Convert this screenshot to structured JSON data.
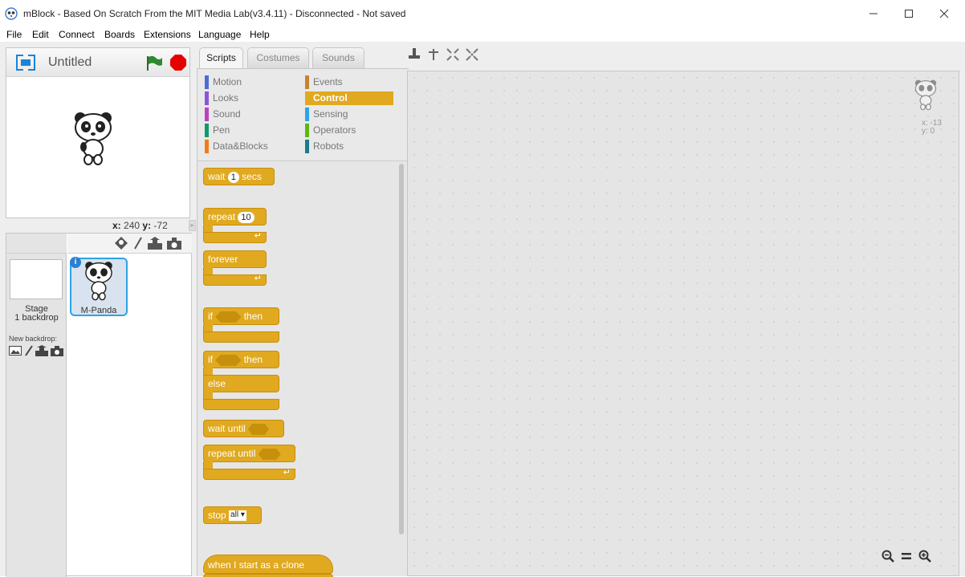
{
  "window": {
    "title": "mBlock - Based On Scratch From the MIT Media Lab(v3.4.11) - Disconnected - Not saved",
    "icon": "mblock-logo-icon",
    "controls": [
      "minimize-icon",
      "maximize-icon",
      "close-icon"
    ]
  },
  "menu": [
    "File",
    "Edit",
    "Connect",
    "Boards",
    "Extensions",
    "Language",
    "Help"
  ],
  "stage": {
    "project_title": "Untitled",
    "icons": [
      "fullscreen-icon",
      "green-flag-icon",
      "stop-icon"
    ],
    "mouse_x_label": "x:",
    "mouse_x": "240",
    "mouse_y_label": "y:",
    "mouse_y": "-72"
  },
  "sprites_panel": {
    "tool_icons": [
      "choose-sprite-icon",
      "paint-sprite-icon",
      "upload-sprite-icon",
      "camera-sprite-icon"
    ],
    "stage_label": "Stage",
    "stage_backdrops": "1 backdrop",
    "new_backdrop_label": "New backdrop:",
    "backdrop_icons": [
      "choose-backdrop-icon",
      "paint-backdrop-icon",
      "upload-backdrop-icon",
      "camera-backdrop-icon"
    ],
    "sprites": [
      {
        "name": "M-Panda",
        "selected": true
      }
    ]
  },
  "tabs": [
    {
      "label": "Scripts",
      "active": true
    },
    {
      "label": "Costumes",
      "active": false
    },
    {
      "label": "Sounds",
      "active": false
    }
  ],
  "edit_tools": [
    "duplicate-tool-icon",
    "delete-tool-icon",
    "grow-tool-icon",
    "shrink-tool-icon"
  ],
  "categories": [
    {
      "label": "Motion",
      "color": "#4a6cd4",
      "selected": false
    },
    {
      "label": "Events",
      "color": "#c88330",
      "selected": false
    },
    {
      "label": "Looks",
      "color": "#8a55d7",
      "selected": false
    },
    {
      "label": "Control",
      "color": "#e0a91f",
      "selected": true
    },
    {
      "label": "Sound",
      "color": "#bb42c3",
      "selected": false
    },
    {
      "label": "Sensing",
      "color": "#2ca5e2",
      "selected": false
    },
    {
      "label": "Pen",
      "color": "#0e9a6c",
      "selected": false
    },
    {
      "label": "Operators",
      "color": "#5cb712",
      "selected": false
    },
    {
      "label": "Data&Blocks",
      "color": "#ee7d16",
      "selected": false
    },
    {
      "label": "Robots",
      "color": "#1c7a8a",
      "selected": false
    }
  ],
  "blocks": {
    "wait": {
      "label": "wait",
      "value": "1",
      "suffix": "secs"
    },
    "repeat": {
      "label": "repeat",
      "value": "10"
    },
    "forever": {
      "label": "forever"
    },
    "if_then": {
      "label": "if",
      "suffix": "then"
    },
    "if_else": {
      "label": "if",
      "suffix": "then",
      "else_label": "else"
    },
    "wait_until": {
      "label": "wait until"
    },
    "repeat_until": {
      "label": "repeat until"
    },
    "stop": {
      "label": "stop",
      "option": "all"
    },
    "clone_hat": {
      "label": "when I start as a clone"
    }
  },
  "scripts_area": {
    "sprite_x_label": "x:",
    "sprite_x": "-13",
    "sprite_y_label": "y:",
    "sprite_y": "0",
    "zoom_icons": [
      "zoom-out-icon",
      "zoom-reset-icon",
      "zoom-in-icon"
    ]
  },
  "colors": {
    "control": "#e0a91f",
    "control_dark": "#c68f0c",
    "selection": "#2ea3e4",
    "green_flag": "#2f8a2f",
    "stop": "#e60000"
  }
}
